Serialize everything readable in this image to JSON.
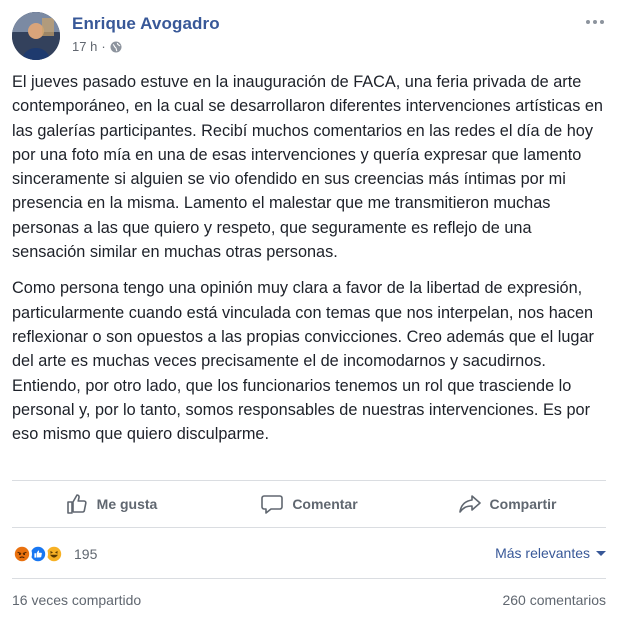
{
  "post": {
    "author": "Enrique Avogadro",
    "time": "17 h",
    "separator": "·",
    "privacy_icon": "globe-icon",
    "paragraphs": [
      "El jueves pasado estuve en la inauguración de FACA, una feria privada de arte contemporáneo, en la cual se desarrollaron diferentes intervenciones artísticas en las galerías participantes. Recibí muchos comentarios en las redes el día de hoy por una foto mía en una de esas intervenciones y quería expresar que lamento sinceramente si alguien se vio ofendido en sus creencias más íntimas por mi presencia en la misma. Lamento el malestar que me transmitieron muchas personas a las que quiero y respeto, que seguramente es reflejo de una sensación similar en muchas otras personas.",
      "Como persona tengo una opinión muy clara a favor de la libertad de expresión, particularmente cuando está vinculada con temas que nos interpelan, nos hacen reflexionar o son opuestos a las propias convicciones. Creo además que el lugar del arte es muchas veces precisamente el de incomodarnos y sacudirnos. Entiendo, por otro lado, que los funcionarios tenemos un rol que trasciende lo personal y, por lo tanto, somos responsables de nuestras intervenciones. Es por eso mismo que quiero disculparme."
    ]
  },
  "actions": {
    "like": "Me gusta",
    "comment": "Comentar",
    "share": "Compartir"
  },
  "reactions": {
    "icons": [
      "angry-icon",
      "like-icon",
      "haha-icon"
    ],
    "count": "195",
    "sort_label": "Más relevantes"
  },
  "footer": {
    "shares": "16 veces compartido",
    "comments": "260 comentarios"
  },
  "colors": {
    "link": "#385898",
    "secondary_text": "#606770",
    "like_blue": "#1877f2",
    "angry": "#e9710f",
    "haha": "#f7b125"
  }
}
